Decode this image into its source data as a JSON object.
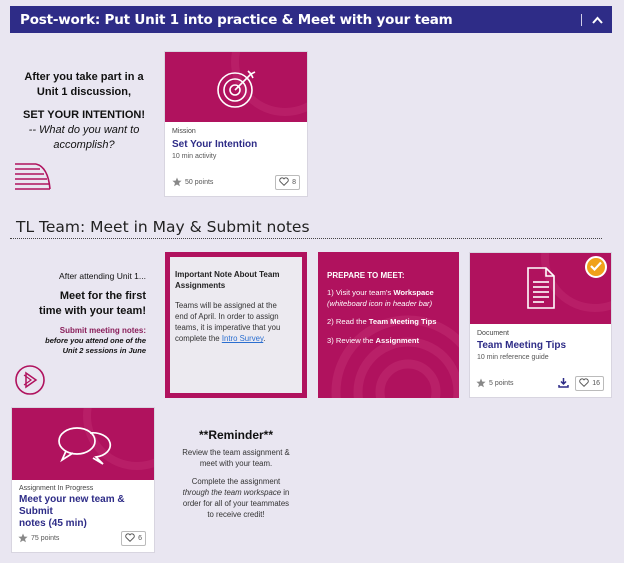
{
  "header": {
    "title": "Post-work: Put Unit 1 into practice & Meet with your team"
  },
  "intro1": {
    "line1": "After you take part in a",
    "line2": "Unit 1 discussion,",
    "line3": "SET YOUR INTENTION!",
    "line4": "-- What do you want to",
    "line5": "accomplish?"
  },
  "mission_card": {
    "type": "Mission",
    "title": "Set Your Intention",
    "meta": "10 min activity",
    "points": "50 points",
    "likes": "8"
  },
  "section2": {
    "title": "TL Team: Meet in May & Submit notes"
  },
  "intro2": {
    "line1": "After attending Unit 1...",
    "line2": "Meet for the first",
    "line3": "time with your team!",
    "line4": "Submit meeting notes:",
    "line5": "before you attend one of the",
    "line6": "Unit 2 sessions in June"
  },
  "note": {
    "title1": "Important Note About Team",
    "title2": "Assignments",
    "b1": "Teams will be assigned at the",
    "b2": "end of April. In order to assign",
    "b3": "teams, it is imperative that you",
    "b4": "complete the ",
    "link": "Intro Survey",
    "b5": "."
  },
  "prepare": {
    "heading": "PREPARE TO MEET:",
    "s1a": "1) Visit your team's ",
    "s1b": "Workspace",
    "s1c": "(whiteboard icon in header bar)",
    "s2a": "2) Read the ",
    "s2b": "Team Meeting Tips",
    "s3a": "3) Review the ",
    "s3b": "Assignment"
  },
  "document_card": {
    "type": "Document",
    "title": "Team Meeting Tips",
    "meta": "10 min reference guide",
    "points": "5 points",
    "likes": "16"
  },
  "assignment_card": {
    "type": "Assignment In Progress",
    "title1": "Meet your new team & Submit",
    "title2": "notes (45 min)",
    "points": "75 points",
    "likes": "6"
  },
  "reminder": {
    "title": "**Reminder**",
    "p1a": "Review the team assignment &",
    "p1b": "meet with your team.",
    "p2a": "Complete the assignment",
    "p2b": "through the team workspace",
    "p2c": " in",
    "p2d": "order for all of your teammates",
    "p2e": "to receive credit!"
  },
  "colors": {
    "header": "#2e2c87",
    "accent": "#b0125e",
    "title": "#2e2c87",
    "check": "#f0a11a"
  },
  "icons": [
    "chevron-up-icon",
    "target-icon",
    "stack-lines-icon",
    "star-icon",
    "heart-icon",
    "play-circle-icon",
    "document-icon",
    "download-icon",
    "checkmark-icon",
    "chat-bubbles-icon"
  ]
}
